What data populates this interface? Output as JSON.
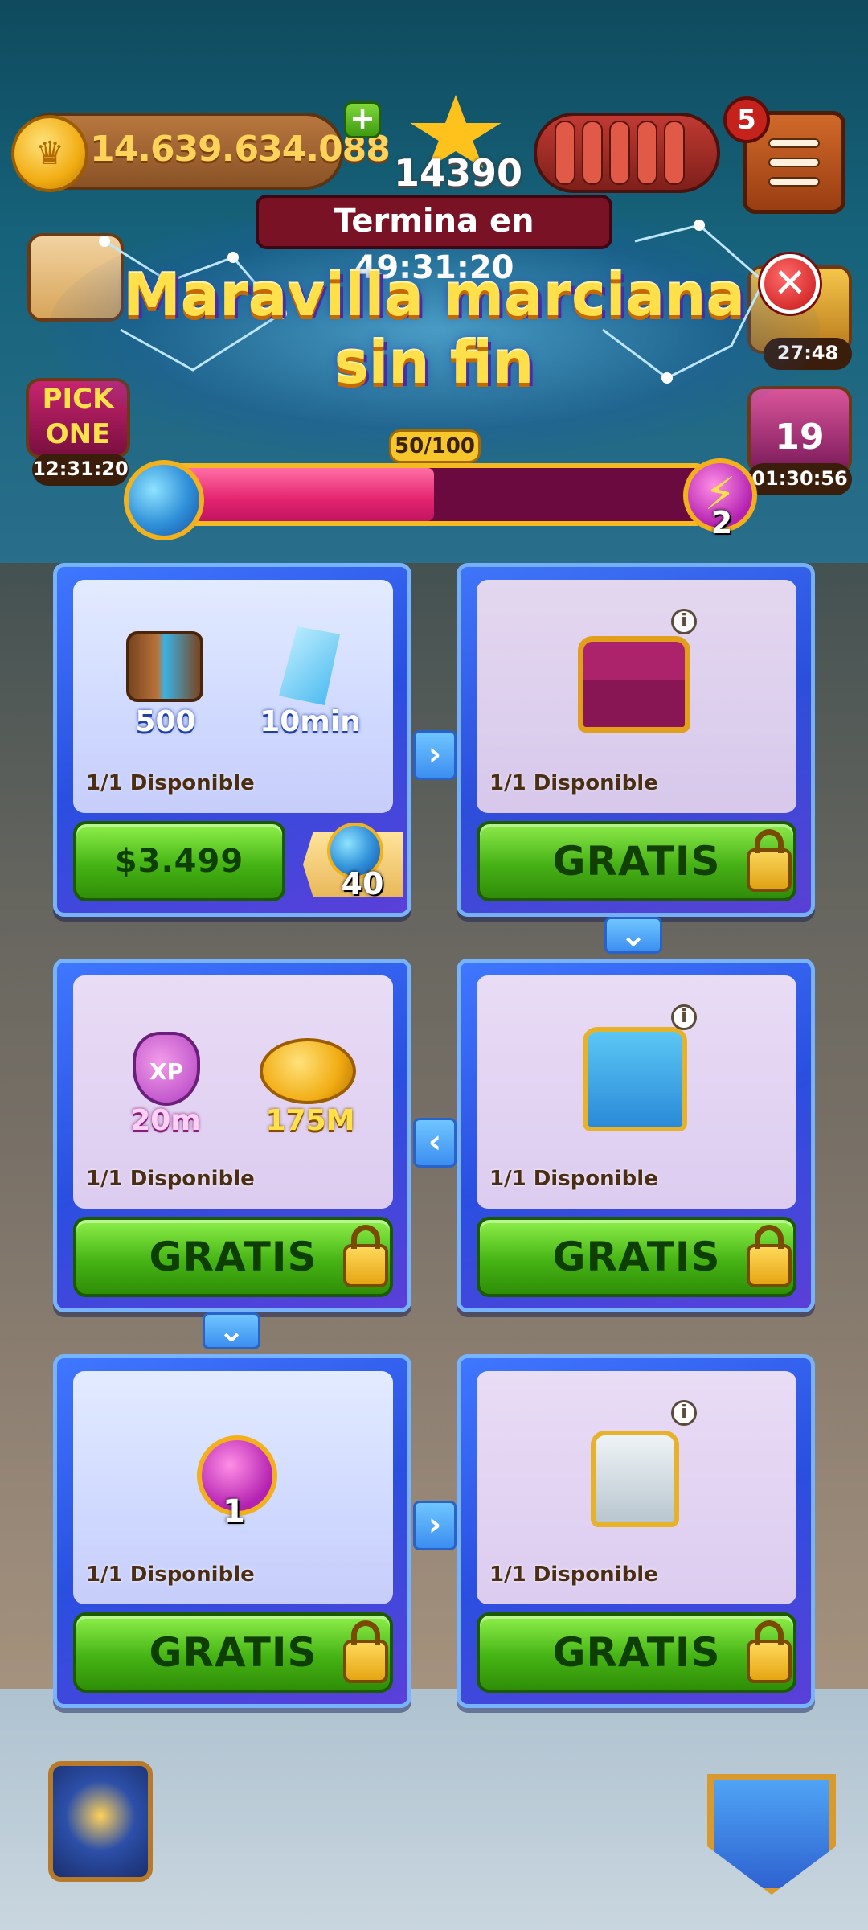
{
  "hud": {
    "coins": "14.639.634.088",
    "stars": "14390",
    "menu_badge": "5",
    "side_timers": [
      "12:31:20",
      "27:48",
      "01:30:56"
    ],
    "side_labels": [
      "PICK ONE",
      "19"
    ]
  },
  "event": {
    "timer": "Termina en 49:31:20",
    "title_line1": "Maravilla marciana",
    "title_line2": "sin fin",
    "progress_label": "50/100",
    "progress_value": 0.5,
    "reward_count": "2"
  },
  "cards": [
    {
      "items": [
        {
          "label": "500"
        },
        {
          "label": "10min"
        }
      ],
      "availability": "1/1  Disponible",
      "button": "$3.499",
      "bonus": "40"
    },
    {
      "items": [],
      "availability": "1/1  Disponible",
      "button": "GRATIS"
    },
    {
      "items": [
        {
          "label": "20m"
        },
        {
          "label": "175M"
        }
      ],
      "availability": "1/1  Disponible",
      "button": "GRATIS"
    },
    {
      "items": [],
      "availability": "1/1  Disponible",
      "button": "GRATIS"
    },
    {
      "items": [
        {
          "label": "1"
        }
      ],
      "availability": "1/1  Disponible",
      "button": "GRATIS"
    },
    {
      "items": [],
      "availability": "1/1  Disponible",
      "button": "GRATIS"
    }
  ],
  "icons": {
    "xp_label": "XP",
    "info": "i"
  },
  "colors": {
    "accent_green": "#46b415",
    "progress_pink": "#e3236f",
    "banner_red": "#7a1226",
    "title_gold": "#ffe04a"
  }
}
